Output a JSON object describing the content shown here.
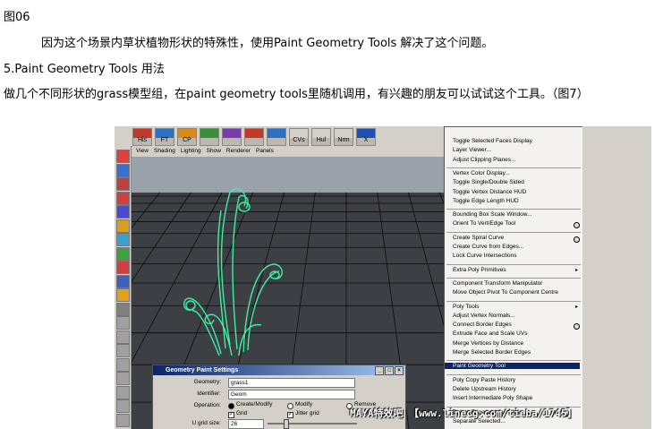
{
  "text": {
    "fig_label": "图06",
    "para1": "因为这个场景内草状植物形状的特殊性，使用Paint Geometry Tools 解决了这个问题。",
    "heading": "5.Paint Geometry Tools 用法",
    "para2": "做几个不同形状的grass模型组，在paint geometry tools里随机调用，有兴趣的朋友可以试试这个工具。（图7）"
  },
  "screenshot": {
    "shelf_buttons": [
      "His",
      "FT",
      "CP",
      "",
      "",
      "",
      "",
      "CVs",
      "Hul",
      "Nrm",
      "X"
    ],
    "viewport_menu": [
      "View",
      "Shading",
      "Lighting",
      "Show",
      "Renderer",
      "Panels"
    ],
    "menu_items": [
      {
        "label": "Toggle Selected Faces Display"
      },
      {
        "label": "Layer Viewer..."
      },
      {
        "label": "Adjust Clipping Planes..."
      },
      {
        "label": "Vertex Color Display..."
      },
      {
        "label": "Toggle Single/Double Sided"
      },
      {
        "label": "Toggle Vertex Distance HUD"
      },
      {
        "label": "Toggle Edge Length HUD"
      },
      {
        "label": "Bounding Box Scale Window..."
      },
      {
        "label": "Orient To Vert/Edge Tool"
      },
      {
        "label": "Create Spiral Curve"
      },
      {
        "label": "Create Curve from Edges..."
      },
      {
        "label": "Lock Curve Intersections"
      },
      {
        "label": "Extra Poly Primitives"
      },
      {
        "label": "Component Transform Manipulator"
      },
      {
        "label": "Move Object Pivot To Component Centre"
      },
      {
        "label": "Poly Tools"
      },
      {
        "label": "Adjust Vertex Normals..."
      },
      {
        "label": "Connect Border Edges"
      },
      {
        "label": "Extrude Face and Scale UVs"
      },
      {
        "label": "Merge Vertices by Distance"
      },
      {
        "label": "Merge Selected Border Edges"
      },
      {
        "label": "Paint Geometry Tool"
      },
      {
        "label": "Poly Copy Paste History"
      },
      {
        "label": "Delete Upstream History"
      },
      {
        "label": "Insert Intermediate Poly Shape"
      },
      {
        "label": "Delete Edge and Cut UVs"
      },
      {
        "label": "Separate Selected..."
      }
    ],
    "dialog": {
      "title": "Geometry Paint Settings",
      "geometry_label": "Geometry:",
      "geometry_value": "grass1",
      "identifier_label": "Identifier:",
      "identifier_value": "Geom",
      "operation_label": "Operation:",
      "op_create": "Create/Modify",
      "op_modify": "Modify",
      "op_remove": "Remove",
      "grid_label": "Grid",
      "jitter_label": "Jitter grid",
      "ugrid_label": "U grid size:",
      "ugrid_value": "26"
    },
    "watermark": "MAYA特效吧 【www.linecg.com/tieba/1745】"
  }
}
